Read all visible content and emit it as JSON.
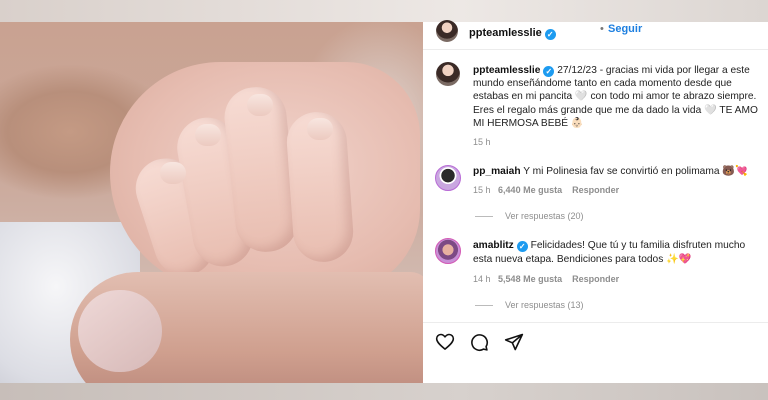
{
  "post": {
    "author": "ppteamlesslie",
    "follow_label": "Seguir",
    "separator": "•",
    "caption_author": "ppteamlesslie",
    "caption_text": " 27/12/23 - gracias mi vida por llegar a este mundo enseñándome tanto en cada momento desde que estabas en mi pancita 🤍 con todo mi amor te abrazo siempre. Eres el regalo más grande que me da dado la vida 🤍 TE AMO MI HERMOSA BEBÉ 👶🏻",
    "caption_time": "15 h"
  },
  "comments": [
    {
      "user": "pp_maiah",
      "text": " Y mi Polinesia fav se convirtió en polimama 🐻💘",
      "time": "15 h",
      "likes": "6,440 Me gusta",
      "reply_label": "Responder",
      "replies_label": "Ver respuestas (20)"
    },
    {
      "user": "amablitz",
      "text": " Felicidades! Que tú y tu familia disfruten mucho esta nueva etapa. Bendiciones para todos ✨💖",
      "time": "14 h",
      "likes": "5,548 Me gusta",
      "reply_label": "Responder",
      "replies_label": "Ver respuestas (13)"
    }
  ],
  "actions": {
    "like_icon": "heart-icon",
    "comment_icon": "comment-icon",
    "share_icon": "paper-plane-icon"
  },
  "colors": {
    "verified": "#1d9bf0",
    "link": "#1d7fe0",
    "muted": "#8e8e8e"
  }
}
